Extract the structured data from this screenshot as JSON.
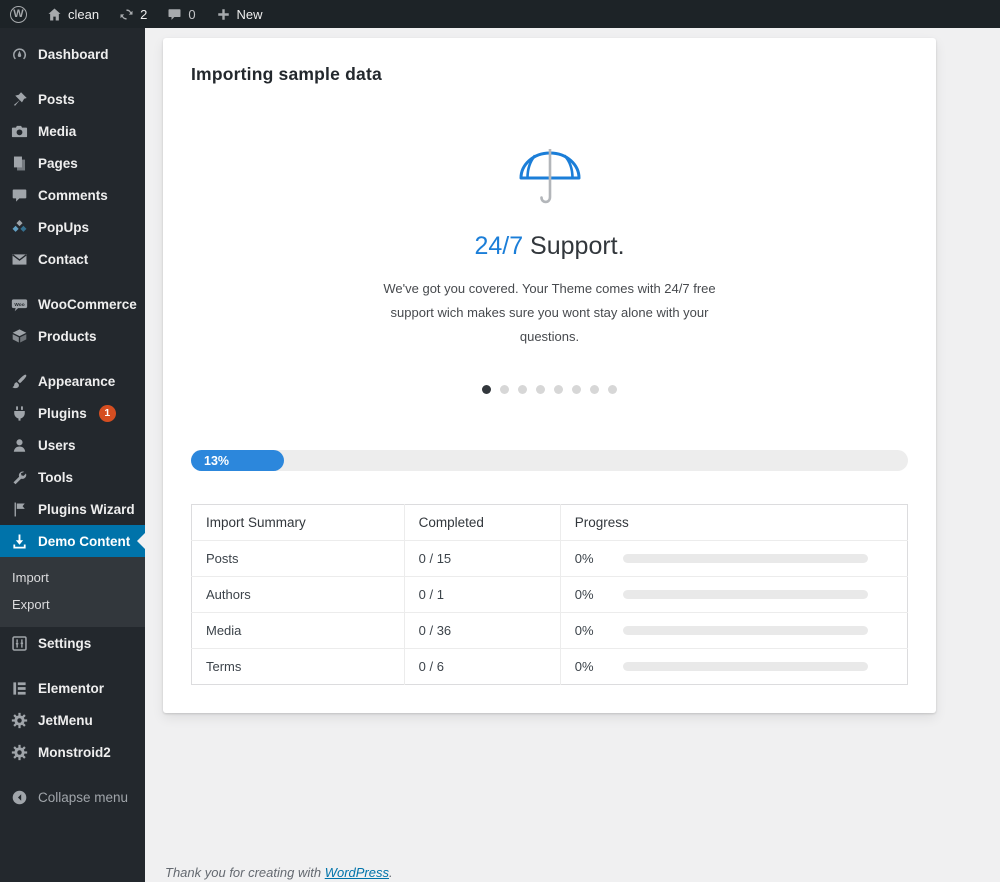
{
  "colors": {
    "admin_bar_bg": "#1d2327",
    "sidebar_bg": "#23282d",
    "submenu_bg": "#32373c",
    "active_item_blue": "#0073aa",
    "badge_orange": "#d54e21",
    "content_bg": "#f0f0f1",
    "progress_blue": "#2c87dc",
    "accent_text_blue": "#1b7ed8",
    "link_blue": "#0073aa"
  },
  "admin_bar": {
    "site_name": "clean",
    "updates_count": "2",
    "comments_count": "0",
    "new_label": "New"
  },
  "sidebar": {
    "items": [
      {
        "label": "Dashboard",
        "icon": "dashboard-icon"
      },
      {
        "label": "Posts",
        "icon": "pin-icon",
        "gap_before": true
      },
      {
        "label": "Media",
        "icon": "camera-icon"
      },
      {
        "label": "Pages",
        "icon": "pages-icon"
      },
      {
        "label": "Comments",
        "icon": "comment-icon"
      },
      {
        "label": "PopUps",
        "icon": "popups-diamonds-icon"
      },
      {
        "label": "Contact",
        "icon": "envelope-icon"
      },
      {
        "label": "WooCommerce",
        "icon": "woocommerce-icon",
        "gap_before": true
      },
      {
        "label": "Products",
        "icon": "box-icon"
      },
      {
        "label": "Appearance",
        "icon": "brush-icon",
        "gap_before": true
      },
      {
        "label": "Plugins",
        "icon": "plugin-icon",
        "badge": "1"
      },
      {
        "label": "Users",
        "icon": "user-icon"
      },
      {
        "label": "Tools",
        "icon": "wrench-icon"
      },
      {
        "label": "Plugins Wizard",
        "icon": "flag-icon"
      },
      {
        "label": "Demo Content",
        "icon": "download-icon",
        "active": true,
        "submenu": [
          "Import",
          "Export"
        ]
      },
      {
        "label": "Settings",
        "icon": "sliders-icon"
      },
      {
        "label": "Elementor",
        "icon": "elementor-icon",
        "gap_before": true
      },
      {
        "label": "JetMenu",
        "icon": "gear-icon"
      },
      {
        "label": "Monstroid2",
        "icon": "gear-icon"
      },
      {
        "label": "Collapse menu",
        "icon": "collapse-arrow-icon",
        "gap_before": true,
        "muted": true
      }
    ]
  },
  "main": {
    "title": "Importing sample data",
    "slide": {
      "icon": "umbrella-icon",
      "heading_accent": "24/7",
      "heading_rest": " Support.",
      "description": "We've got you covered. Your Theme comes with 24/7 free support wich makes sure you wont stay alone with your questions.",
      "dots_total": 8,
      "dots_active_index": 0
    },
    "progress": {
      "label": "13%",
      "percent": 13
    },
    "table": {
      "headers": [
        "Import Summary",
        "Completed",
        "Progress"
      ],
      "rows": [
        {
          "name": "Posts",
          "completed": "0 / 15",
          "progress_label": "0%",
          "progress_percent": 0
        },
        {
          "name": "Authors",
          "completed": "0 / 1",
          "progress_label": "0%",
          "progress_percent": 0
        },
        {
          "name": "Media",
          "completed": "0 / 36",
          "progress_label": "0%",
          "progress_percent": 0
        },
        {
          "name": "Terms",
          "completed": "0 / 6",
          "progress_label": "0%",
          "progress_percent": 0
        }
      ]
    }
  },
  "footer": {
    "text": "Thank you for creating with ",
    "link_label": "WordPress",
    "suffix": "."
  }
}
